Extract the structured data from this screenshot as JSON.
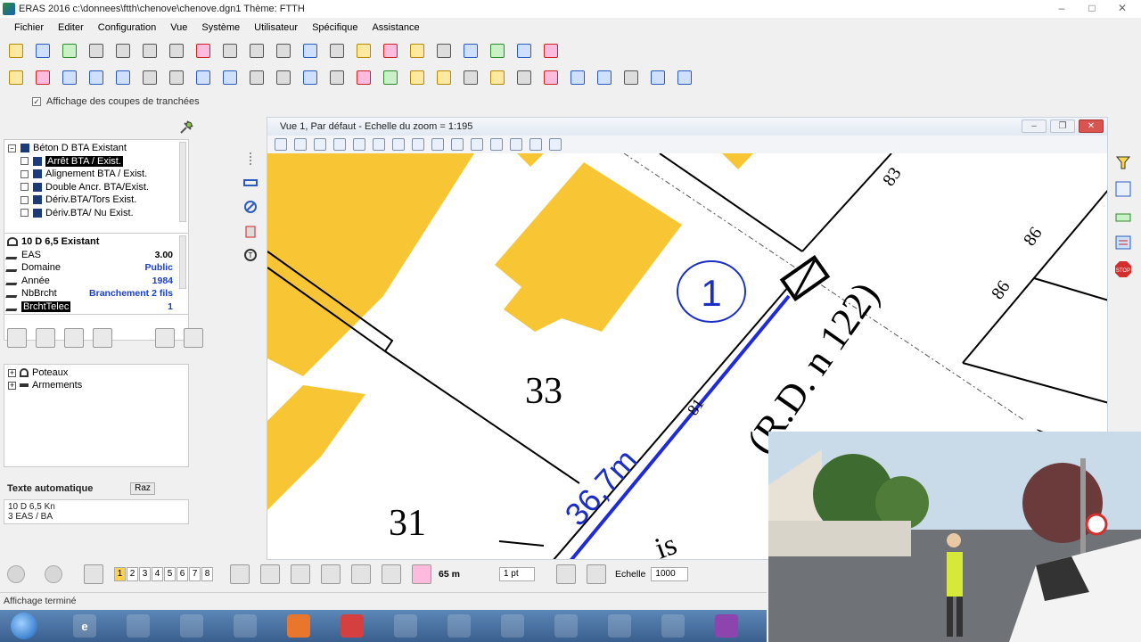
{
  "window": {
    "title": "ERAS 2016 c:\\donnees\\ftth\\chenove\\chenove.dgn1 Thème:  FTTH"
  },
  "menu": [
    "Fichier",
    "Editer",
    "Configuration",
    "Vue",
    "Système",
    "Utilisateur",
    "Spécifique",
    "Assistance"
  ],
  "options": {
    "trench_checkbox_label": "Affichage des coupes de tranchées",
    "trench_checked": true
  },
  "tree_top": {
    "group_label": "Béton D BTA Existant",
    "items": [
      {
        "label": "Arrêt BTA / Exist.",
        "selected": true
      },
      {
        "label": "Alignement BTA / Exist."
      },
      {
        "label": "Double Ancr. BTA/Exist."
      },
      {
        "label": "Dériv.BTA/Tors Exist."
      },
      {
        "label": "Dériv.BTA/ Nu Exist."
      }
    ]
  },
  "properties": {
    "header": "10 D 6,5 Existant",
    "rows": [
      {
        "key": "EAS",
        "value": "3.00"
      },
      {
        "key": "Domaine",
        "value": "Public"
      },
      {
        "key": "Année",
        "value": "1984"
      },
      {
        "key": "NbBrcht",
        "value": "Branchement 2 fils"
      },
      {
        "key": "BrchtTelec",
        "value": "1"
      }
    ]
  },
  "tree_bottom": {
    "items": [
      "Poteaux",
      "Armements"
    ]
  },
  "auto_text": {
    "label": "Texte automatique",
    "reset_label": "Raz",
    "lines": [
      "10 D 6,5 Kn",
      "3 EAS / BA"
    ]
  },
  "view": {
    "title": "Vue 1, Par défaut - Echelle du zoom = 1:195"
  },
  "map_labels": {
    "parcel_33": "33",
    "parcel_31": "31",
    "circle_number": "1",
    "road_name": "(R.D. n 122)",
    "distance": "36,7m",
    "num_83": "83",
    "num_86a": "86",
    "num_86b": "86",
    "num_81": "81",
    "partial_is": "is",
    "partial_r": "R"
  },
  "statusbar": {
    "pages": [
      "1",
      "2",
      "3",
      "4",
      "5",
      "6",
      "7",
      "8"
    ],
    "active_page": "1",
    "distance": "65 m",
    "line_weight": "1 pt",
    "scale_label": "Echelle",
    "scale_value": "1000",
    "status_message": "Affichage terminé"
  },
  "colors": {
    "building_fill": "#f8c635",
    "cable_line": "#1f2bd4",
    "map_label_blue": "#1b2fc4",
    "taskbar": "#3a5f8f"
  }
}
